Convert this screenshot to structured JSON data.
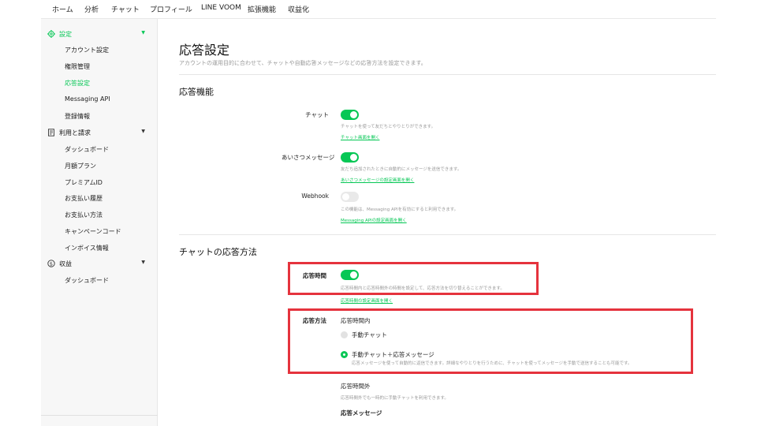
{
  "top_nav": [
    "ホーム",
    "分析",
    "チャット",
    "プロフィール",
    "LINE VOOM",
    "拡張機能",
    "収益化"
  ],
  "sidebar": {
    "sections": [
      {
        "label": "設定",
        "icon": "gear-icon",
        "items": [
          "アカウント設定",
          "権限管理",
          "応答設定",
          "Messaging API",
          "登録情報"
        ],
        "active_item": "応答設定"
      },
      {
        "label": "利用と請求",
        "icon": "receipt-icon",
        "items": [
          "ダッシュボード",
          "月額プラン",
          "プレミアムID",
          "お支払い履歴",
          "お支払い方法",
          "キャンペーンコード",
          "インボイス情報"
        ]
      },
      {
        "label": "収益",
        "icon": "dollar-icon",
        "items": [
          "ダッシュボード"
        ]
      }
    ]
  },
  "page": {
    "title": "応答設定",
    "description": "アカウントの運用目的に合わせて、チャットや自動応答メッセージなどの応答方法を設定できます。"
  },
  "features": {
    "title": "応答機能",
    "rows": [
      {
        "label": "チャット",
        "enabled": true,
        "helper": "チャットを使って友だちとやりとりができます。",
        "link": "チャット画面を開く"
      },
      {
        "label": "あいさつメッセージ",
        "enabled": true,
        "helper": "友だち追加されたときに自動的にメッセージを送信できます。",
        "link": "あいさつメッセージの設定画面を開く"
      },
      {
        "label": "Webhook",
        "enabled": false,
        "helper": "この機能は、Messaging APIを有効にすると利用できます。",
        "link": "Messaging APIの設定画面を開く"
      }
    ]
  },
  "chat_response": {
    "title": "チャットの応答方法",
    "response_hours": {
      "label": "応答時間",
      "enabled": true,
      "helper": "応答時間内と応答時間外の時間を設定して、応答方法を切り替えることができます。",
      "link": "応答時間の設定画面を開く"
    },
    "method": {
      "label": "応答方法",
      "in_hours_label": "応答時間内",
      "options": [
        {
          "label": "手動チャット",
          "selected": false
        },
        {
          "label": "手動チャット＋応答メッセージ",
          "selected": true,
          "helper": "応答メッセージを使って自動的に返信できます。詳細なやりとりを行うために、チャットを使ってメッセージを手動で送信することも可能です。"
        }
      ],
      "out_hours_label": "応答時間外",
      "out_hours_helper": "応答時間外でも一時的に手動チャットを利用できます。",
      "response_message_label": "応答メッセージ"
    }
  },
  "colors": {
    "accent": "#06c755",
    "highlight": "#e5333d"
  }
}
